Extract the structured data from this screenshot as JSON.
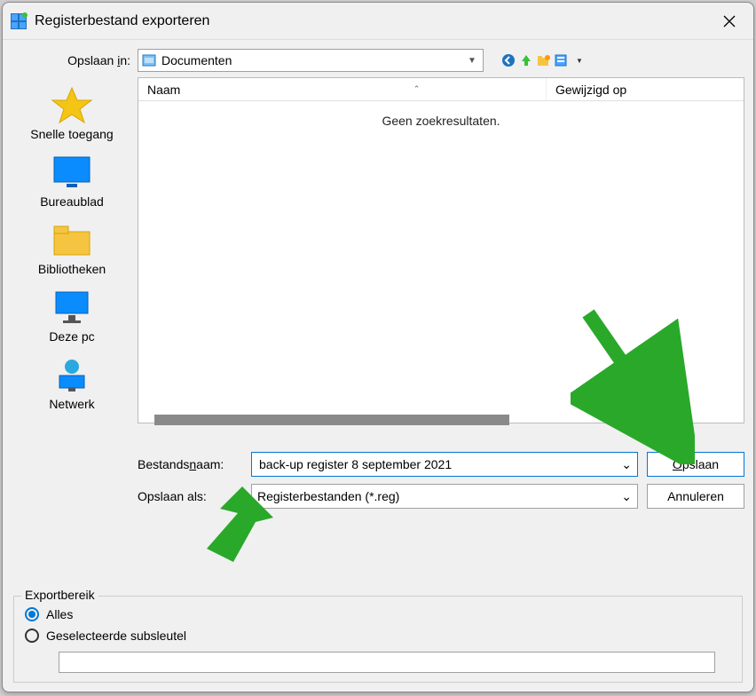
{
  "window": {
    "title": "Registerbestand exporteren"
  },
  "savein": {
    "label_pre": "Opslaan ",
    "label_ul": "i",
    "label_post": "n:",
    "value": "Documenten"
  },
  "sidebar": {
    "items": [
      {
        "label": "Snelle toegang"
      },
      {
        "label": "Bureaublad"
      },
      {
        "label": "Bibliotheken"
      },
      {
        "label": "Deze pc"
      },
      {
        "label": "Netwerk"
      }
    ]
  },
  "listview": {
    "columns": {
      "name": "Naam",
      "modified": "Gewijzigd op"
    },
    "empty": "Geen zoekresultaten."
  },
  "form": {
    "filename_label_pre": "Bestands",
    "filename_label_ul": "n",
    "filename_label_post": "aam:",
    "filename_value": "back-up register 8 september 2021",
    "saveas_label": "Opslaan als:",
    "saveas_value": "Registerbestanden (*.reg)"
  },
  "buttons": {
    "save_pre": "",
    "save_ul": "O",
    "save_post": "pslaan",
    "cancel": "Annuleren"
  },
  "export": {
    "legend": "Exportbereik",
    "all_label": "Alles",
    "selected_label": "Geselecteerde subsleutel",
    "selected_value": ""
  }
}
